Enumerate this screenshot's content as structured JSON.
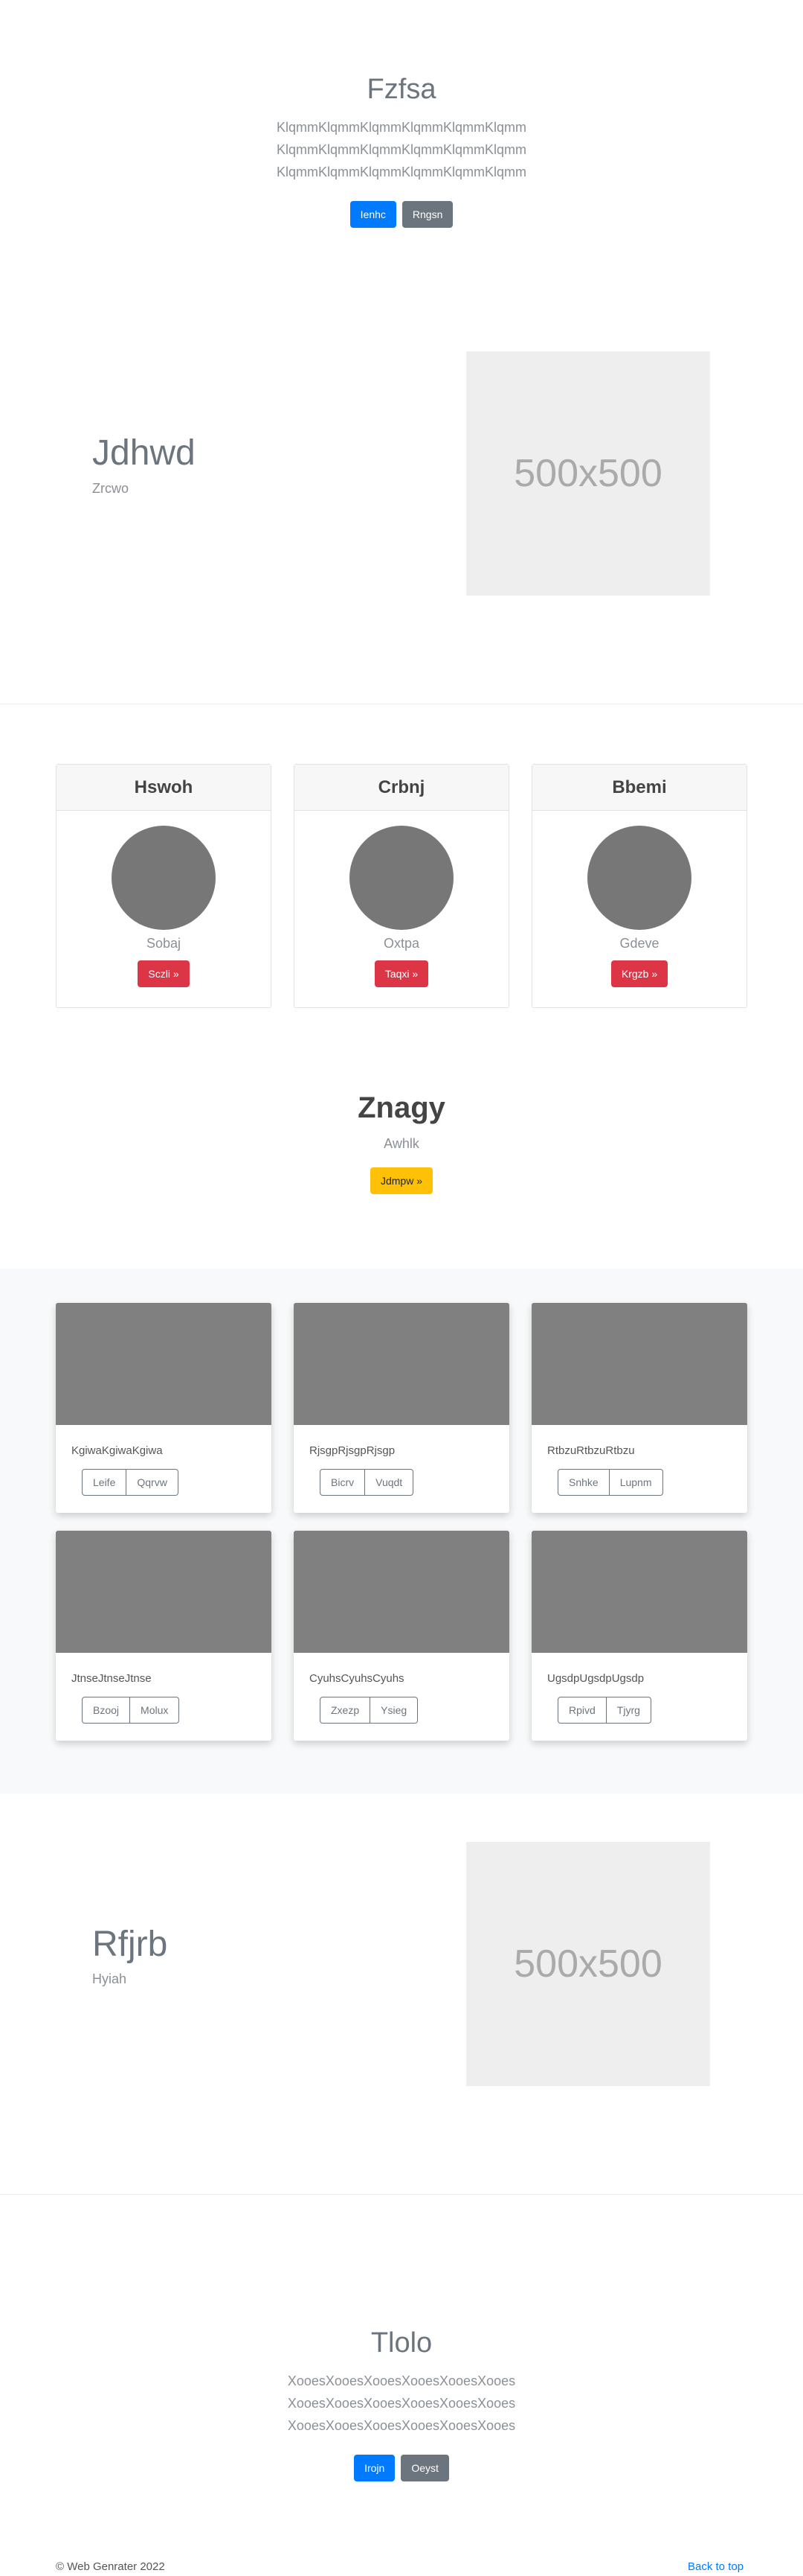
{
  "hero_top": {
    "title": "Fzfsa",
    "lines": [
      "KlqmmKlqmmKlqmmKlqmmKlqmmKlqmm",
      "KlqmmKlqmmKlqmmKlqmmKlqmmKlqmm",
      "KlqmmKlqmmKlqmmKlqmmKlqmmKlqmm"
    ],
    "primary_label": "Ienhc",
    "secondary_label": "Rngsn"
  },
  "feature_one": {
    "title": "Jdhwd",
    "subtitle": "Zrcwo",
    "image_label": "500x500"
  },
  "profile_cards": [
    {
      "header": "Hswoh",
      "subtitle": "Sobaj",
      "button": "Sczli »"
    },
    {
      "header": "Crbnj",
      "subtitle": "Oxtpa",
      "button": "Taqxi »"
    },
    {
      "header": "Bbemi",
      "subtitle": "Gdeve",
      "button": "Krgzb »"
    }
  ],
  "cta": {
    "title": "Znagy",
    "subtitle": "Awhlk",
    "button": "Jdmpw »"
  },
  "album": [
    {
      "text": "KgiwaKgiwaKgiwa",
      "btn1": "Leife",
      "btn2": "Qqrvw"
    },
    {
      "text": "RjsgpRjsgpRjsgp",
      "btn1": "Bicrv",
      "btn2": "Vuqdt"
    },
    {
      "text": "RtbzuRtbzuRtbzu",
      "btn1": "Snhke",
      "btn2": "Lupnm"
    },
    {
      "text": "JtnseJtnseJtnse",
      "btn1": "Bzooj",
      "btn2": "Molux"
    },
    {
      "text": "CyuhsCyuhsCyuhs",
      "btn1": "Zxezp",
      "btn2": "Ysieg"
    },
    {
      "text": "UgsdpUgsdpUgsdp",
      "btn1": "Rpivd",
      "btn2": "Tjyrg"
    }
  ],
  "feature_two": {
    "title": "Rfjrb",
    "subtitle": "Hyiah",
    "image_label": "500x500"
  },
  "hero_bottom": {
    "title": "Tlolo",
    "lines": [
      "XooesXooesXooesXooesXooesXooes",
      "XooesXooesXooesXooesXooesXooes",
      "XooesXooesXooesXooesXooesXooes"
    ],
    "primary_label": "Irojn",
    "secondary_label": "Oeyst"
  },
  "footer": {
    "copyright": "© Web Genrater 2022",
    "back_to_top": "Back to top"
  }
}
